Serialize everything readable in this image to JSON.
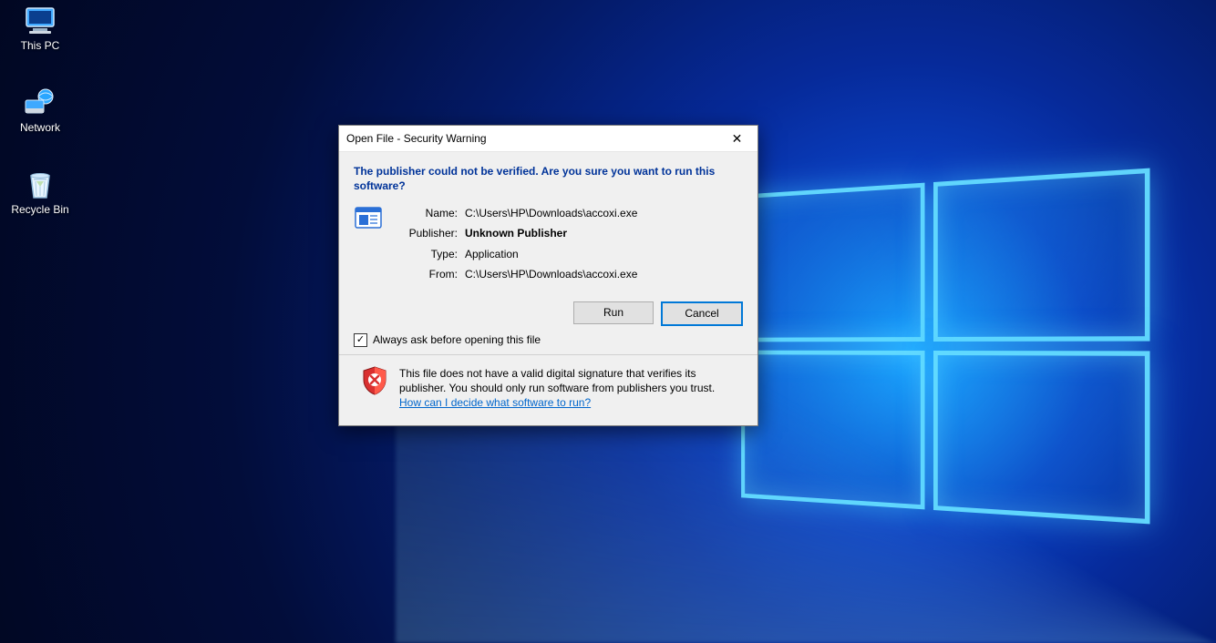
{
  "desktop": {
    "icons": [
      {
        "name": "this-pc",
        "label": "This PC"
      },
      {
        "name": "network",
        "label": "Network"
      },
      {
        "name": "recycle-bin",
        "label": "Recycle Bin"
      }
    ]
  },
  "dialog": {
    "title": "Open File - Security Warning",
    "heading": "The publisher could not be verified.  Are you sure you want to run this software?",
    "labels": {
      "name": "Name:",
      "publisher": "Publisher:",
      "type": "Type:",
      "from": "From:"
    },
    "values": {
      "name": "C:\\Users\\HP\\Downloads\\accoxi.exe",
      "publisher": "Unknown Publisher",
      "type": "Application",
      "from": "C:\\Users\\HP\\Downloads\\accoxi.exe"
    },
    "buttons": {
      "run": "Run",
      "cancel": "Cancel"
    },
    "checkbox": {
      "checked": true,
      "label": "Always ask before opening this file"
    },
    "warning": {
      "text": "This file does not have a valid digital signature that verifies its publisher.  You should only run software from publishers you trust.",
      "link": "How can I decide what software to run?"
    }
  }
}
